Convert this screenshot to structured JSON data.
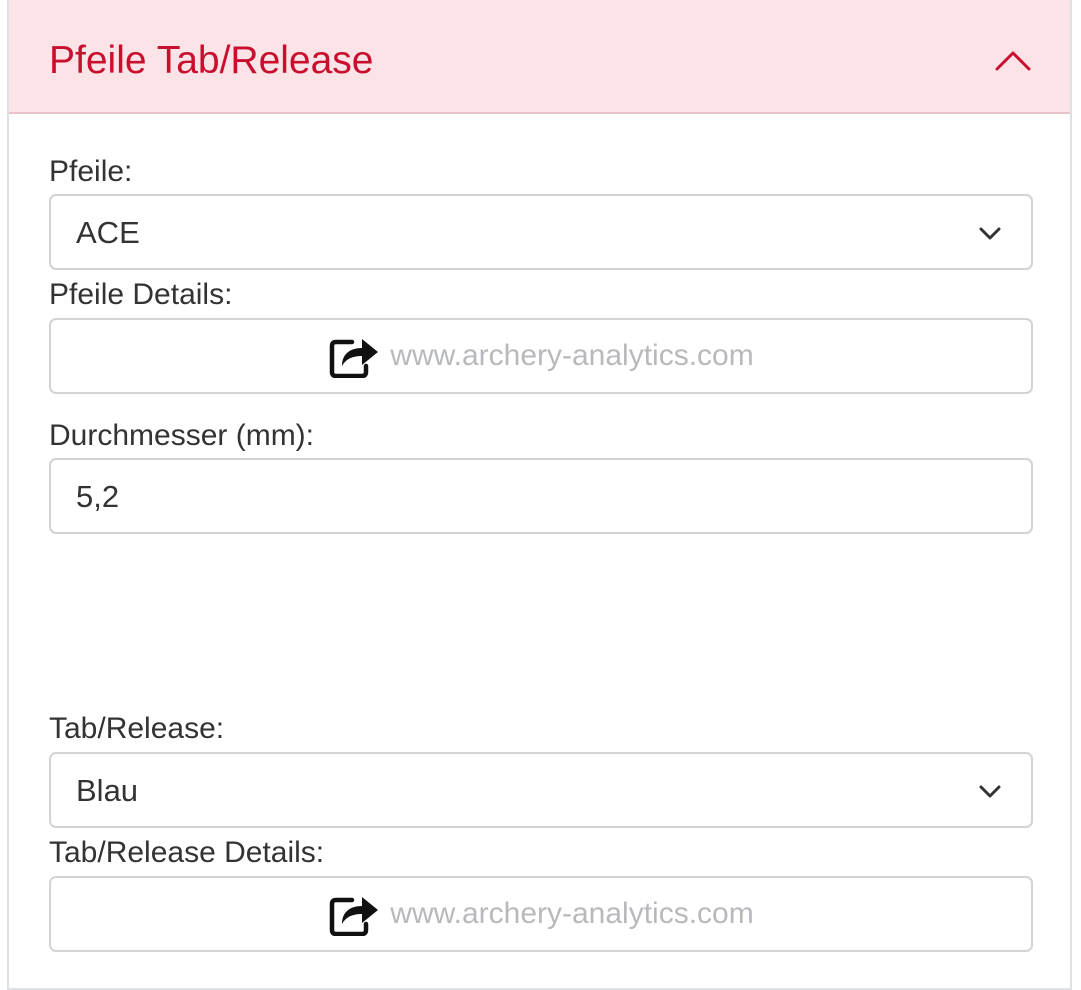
{
  "panel": {
    "title": "Pfeile Tab/Release",
    "collapse_icon": "chevron-up-icon",
    "accent_color": "#c8102e",
    "header_bg": "#fbe3e7"
  },
  "arrows": {
    "label": "Pfeile:",
    "selected": "ACE",
    "dropdown_icon": "chevron-down-icon"
  },
  "arrow_details": {
    "label": "Pfeile Details:",
    "link_icon": "share-icon",
    "link_text": "www.archery-analytics.com"
  },
  "diameter": {
    "label": "Durchmesser (mm):",
    "value": "5,2"
  },
  "tab_release": {
    "label": "Tab/Release:",
    "selected": "Blau",
    "dropdown_icon": "chevron-down-icon"
  },
  "tab_release_details": {
    "label": "Tab/Release Details:",
    "link_icon": "share-icon",
    "link_text": "www.archery-analytics.com"
  }
}
